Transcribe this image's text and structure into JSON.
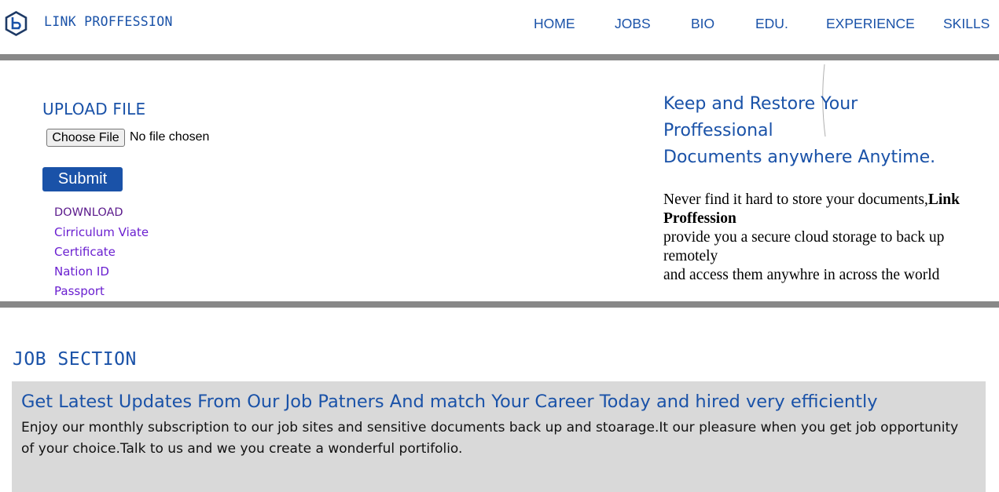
{
  "header": {
    "brand": "LINK PROFFESSION",
    "nav": [
      "HOME",
      "JOBS",
      "BIO",
      "EDU.",
      "EXPERIENCE",
      "SKILLS"
    ]
  },
  "upload": {
    "title": "UPLOAD FILE",
    "choose_label": "Choose File",
    "no_file_text": "No file chosen",
    "submit_label": "Submit"
  },
  "download": {
    "title": "DOWNLOAD",
    "links": [
      "Cirriculum Viate",
      "Certificate",
      "Nation ID",
      "Passport"
    ]
  },
  "promo": {
    "heading_lines": [
      "Keep and Restore Your",
      "Proffessional",
      "Documents anywhere Anytime."
    ],
    "body_prefix": "Never find it hard to store your documents,",
    "body_brand": "Link Proffession",
    "body_line2": "provide you a secure cloud storage to back up remotely",
    "body_line3": "and access them anywhre in across the world"
  },
  "jobs": {
    "section_title": "JOB SECTION",
    "heading": "Get Latest Updates From Our Job Patners And match Your Career Today and hired very efficiently",
    "text": "Enjoy our monthly subscription to our job sites and sensitive documents back up and stoarage.It our pleasure when you get job opportunity of your choice.Talk to us and we you create a wonderful portifolio."
  },
  "colors": {
    "accent": "#1a52a8",
    "rule": "#888888",
    "job_box": "#d9d9d9",
    "link": "#6a1fd0"
  }
}
